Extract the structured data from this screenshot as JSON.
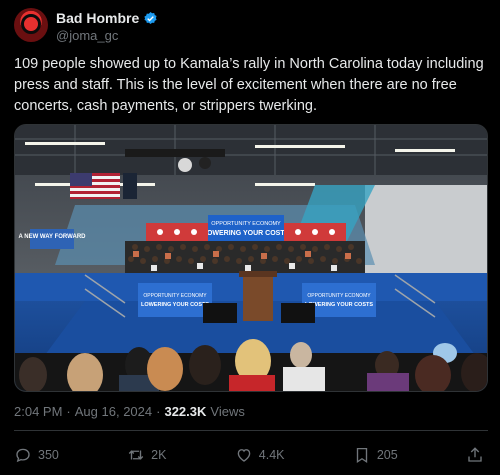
{
  "author": {
    "name": "Bad Hombre",
    "handle": "@joma_gc",
    "verified_color": "#1d9bf0",
    "avatar_color": "#e8302f"
  },
  "tweet": {
    "text": "109 people showed up to Kamala’s rally in North Carolina today including press and staff. This is the level of excitement when there are no free concerts, cash payments, or strippers twerking."
  },
  "media": {
    "signs": {
      "left_banner": "A NEW WAY FORWARD",
      "top_banner_line1": "OPPORTUNITY ECONOMY",
      "top_banner_line2": "LOWERING YOUR COSTS",
      "podium_left_line1": "OPPORTUNITY ECONOMY",
      "podium_left_line2": "LOWERING YOUR COSTS",
      "podium_right_line1": "OPPORTUNITY ECONOMY",
      "podium_right_line2": "LOWERING YOUR COSTS"
    }
  },
  "meta": {
    "time": "2:04 PM",
    "separator": "·",
    "date": "Aug 16, 2024",
    "views_count": "322.3K",
    "views_label": "Views"
  },
  "actions": {
    "replies": "350",
    "reposts": "2K",
    "likes": "4.4K",
    "bookmarks": "205"
  }
}
